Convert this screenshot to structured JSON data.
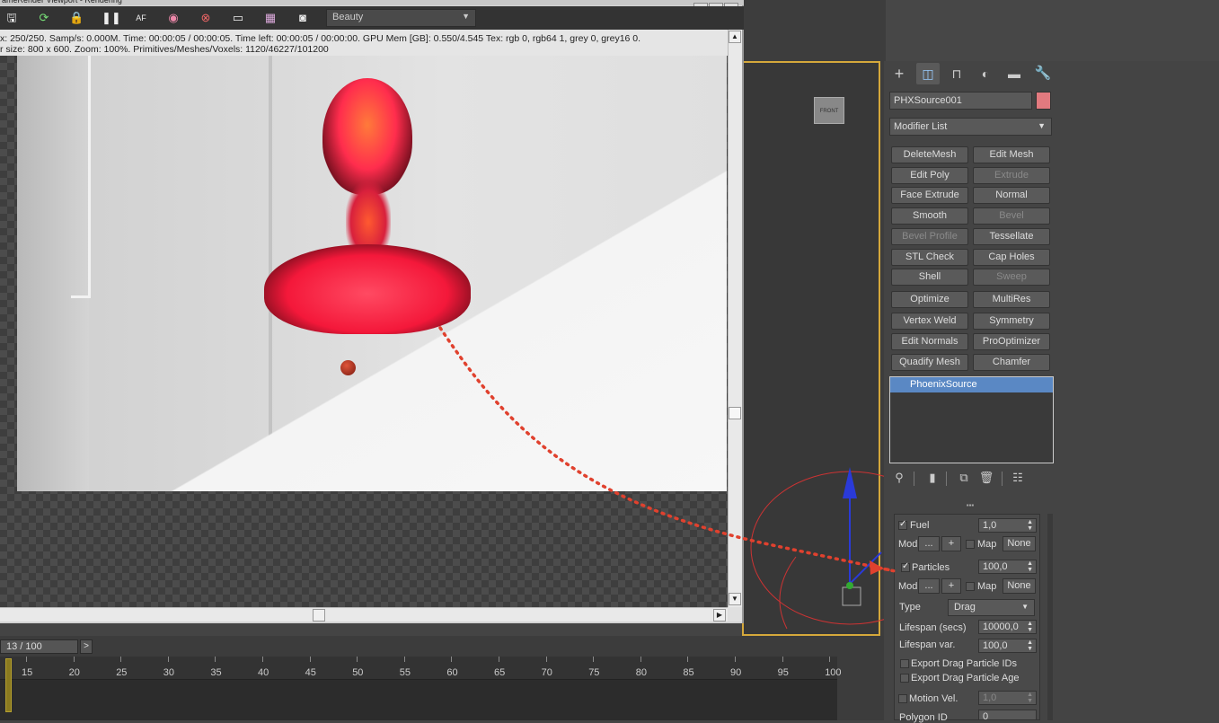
{
  "render_window": {
    "title": "ameRender Viewport - Rendering",
    "channel": "Beauty",
    "toolbar_icons": [
      "save-icon",
      "refresh-icon",
      "lock-icon",
      "pause-icon",
      "af-icon",
      "color-wheel-icon",
      "no-region-icon",
      "monitor-icon",
      "history-icon",
      "camera-icon"
    ],
    "stats_line1": "x: 250/250.   Samp/s: 0.000M.   Time: 00:00:05 / 00:00:05.   Time left: 00:00:05 / 00:00:00.   GPU Mem [GB]: 0.550/4.545   Tex: rgb 0, rgb64 1, grey 0, grey16 0.",
    "stats_line2": "r size: 800 x 600.   Zoom: 100%.   Primitives/Meshes/Voxels: 1120/46227/101200"
  },
  "timeline": {
    "frame": "13 / 100",
    "next_label": ">",
    "ticks": [
      "15",
      "20",
      "25",
      "30",
      "35",
      "40",
      "45",
      "50",
      "55",
      "60",
      "65",
      "70",
      "75",
      "80",
      "85",
      "90",
      "95",
      "100"
    ]
  },
  "command_panel": {
    "tabs": [
      "create-icon",
      "modify-icon",
      "hierarchy-icon",
      "motion-icon",
      "display-icon",
      "utilities-icon"
    ],
    "object_name": "PHXSource001",
    "object_color": "#e27a7f",
    "modifier_list": "Modifier List",
    "modifier_buttons": [
      [
        "DeleteMesh",
        "Edit Mesh"
      ],
      [
        "Edit Poly",
        "Extrude"
      ],
      [
        "Face Extrude",
        "Normal"
      ],
      [
        "Smooth",
        "Bevel"
      ],
      [
        "Bevel Profile",
        "Tessellate"
      ],
      [
        "STL Check",
        "Cap Holes"
      ],
      [
        "Shell",
        "Sweep"
      ],
      [
        "Optimize",
        "MultiRes"
      ],
      [
        "Vertex Weld",
        "Symmetry"
      ],
      [
        "Edit Normals",
        "ProOptimizer"
      ],
      [
        "Quadify Mesh",
        "Chamfer"
      ]
    ],
    "stack_item": "PhoenixSource"
  },
  "rollout": {
    "fuel_label": "Fuel",
    "fuel_value": "1,0",
    "mod_label": "Mod",
    "dots_label": "...",
    "plus_label": "+",
    "map_label": "Map",
    "none_label": "None",
    "particles_label": "Particles",
    "particles_value": "100,0",
    "type_label": "Type",
    "type_value": "Drag",
    "lifespan_label": "Lifespan (secs)",
    "lifespan_value": "10000,0",
    "lifespan_var_label": "Lifespan var.",
    "lifespan_var_value": "100,0",
    "export_ids_label": "Export Drag Particle IDs",
    "export_age_label": "Export Drag Particle Age",
    "motion_vel_label": "Motion Vel.",
    "motion_vel_value": "1,0",
    "polygon_id_label": "Polygon ID",
    "polygon_id_value": "0"
  },
  "viewport": {
    "viewcube_label": "FRONT"
  }
}
